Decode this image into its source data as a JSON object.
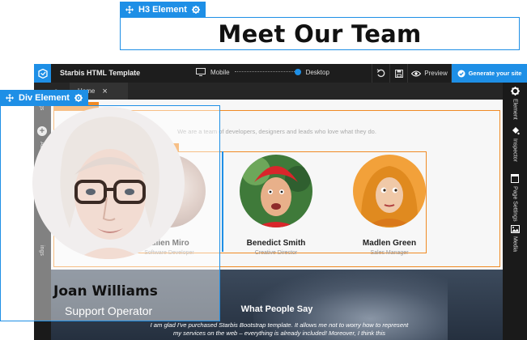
{
  "h3_element": {
    "tag_label": "H3 Element",
    "heading": "Meet Our Team"
  },
  "div_element": {
    "tag_label": "Div Element",
    "name": "Joan Williams",
    "role": "Support Operator"
  },
  "topbar": {
    "title": "Starbis HTML Template",
    "device_left": "Mobile",
    "device_right": "Desktop",
    "preview_label": "Preview",
    "generate_label": "Generate your site"
  },
  "tabbar": {
    "left_text": "a",
    "home_tab": "Home",
    "close_glyph": "×"
  },
  "left_rail": {
    "label_top": "gs",
    "label_mid": "Adv",
    "label_bottom": "ings"
  },
  "right_rail": {
    "element": "Element",
    "inspector": "Inspector",
    "page_settings": "Page Settings",
    "media": "Media"
  },
  "team_section": {
    "intro": "We are a team of developers, designers and leads who love what they do.",
    "members": [
      {
        "name": "allien Miro",
        "role": "Software Developer"
      },
      {
        "name": "Benedict Smith",
        "role": "Creative Director"
      },
      {
        "name": "Madlen Green",
        "role": "Sales Manager"
      }
    ]
  },
  "testimonial": {
    "heading": "What People Say",
    "text": "I am glad I've purchased Starbis Bootstrap template. It allows me not to worry how to represent my services on the web – everything is already included! Moreover, I think this"
  },
  "colors": {
    "accent": "#1e8fe6",
    "outline": "#f08a24",
    "app_bg": "#2b2b2b"
  }
}
